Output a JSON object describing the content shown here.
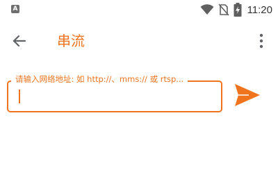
{
  "status_bar": {
    "notification_icon": "A",
    "time": "11:20",
    "icons": [
      "wifi-icon",
      "no-sim-icon",
      "battery-charging-icon"
    ]
  },
  "app_bar": {
    "title": "串流",
    "back_icon": "arrow-left-icon",
    "menu_icon": "more-vert-icon"
  },
  "url_input": {
    "hint": "请输入网络地址: 如 http://、mms:// 或 rtsp...",
    "value": ""
  },
  "send_button": {
    "icon": "send-icon"
  },
  "colors": {
    "accent": "#f0741e",
    "icon": "#5f6368",
    "status_icon": "#6f6f6f"
  }
}
